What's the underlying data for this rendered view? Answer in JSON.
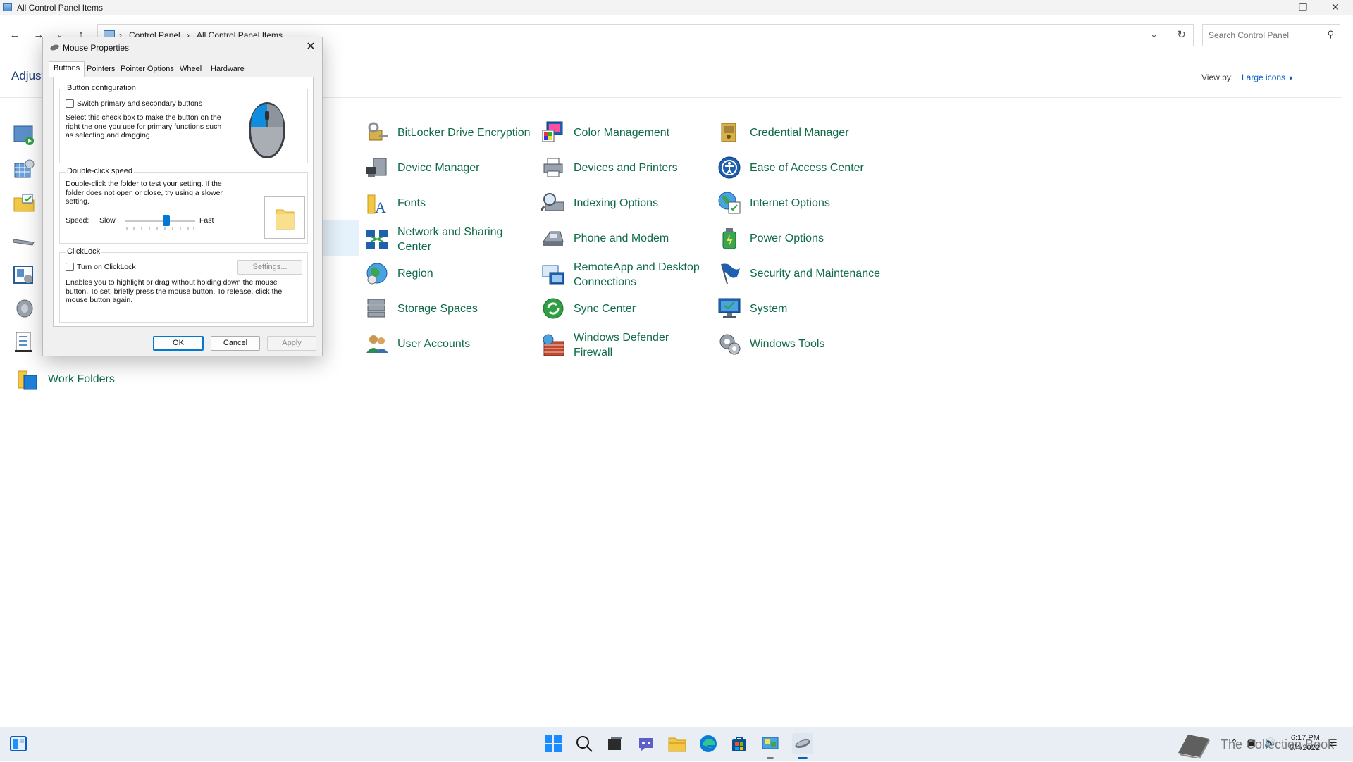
{
  "window": {
    "title": "All Control Panel Items"
  },
  "address": {
    "crumbs": [
      "Control Panel",
      "All Control Panel Items"
    ],
    "search_placeholder": "Search Control Panel"
  },
  "main": {
    "heading": "Adjust",
    "view_by_label": "View by:",
    "view_by_value": "Large icons",
    "items": [
      {
        "label": "BitLocker Drive Encryption",
        "icon": "bitlocker-icon"
      },
      {
        "label": "Color Management",
        "icon": "color-management-icon"
      },
      {
        "label": "Credential Manager",
        "icon": "credential-manager-icon"
      },
      {
        "label": "Device Manager",
        "icon": "device-manager-icon"
      },
      {
        "label": "Devices and Printers",
        "icon": "printer-icon"
      },
      {
        "label": "Ease of Access Center",
        "icon": "ease-of-access-icon"
      },
      {
        "label": "Fonts",
        "icon": "fonts-icon"
      },
      {
        "label": "Indexing Options",
        "icon": "indexing-icon"
      },
      {
        "label": "Internet Options",
        "icon": "internet-options-icon"
      },
      {
        "label_line1": "Network and Sharing",
        "label_line2": "Center",
        "icon": "network-icon"
      },
      {
        "label": "Phone and Modem",
        "icon": "phone-modem-icon"
      },
      {
        "label": "Power Options",
        "icon": "power-options-icon"
      },
      {
        "label": "Region",
        "icon": "region-icon"
      },
      {
        "label_line1": "RemoteApp and Desktop",
        "label_line2": "Connections",
        "icon": "remoteapp-icon"
      },
      {
        "label": "Security and Maintenance",
        "icon": "security-flag-icon"
      },
      {
        "label": "Storage Spaces",
        "icon": "storage-spaces-icon"
      },
      {
        "label": "Sync Center",
        "icon": "sync-center-icon"
      },
      {
        "label": "System",
        "icon": "system-monitor-icon"
      },
      {
        "label": "User Accounts",
        "icon": "user-accounts-icon"
      },
      {
        "label_line1": "Windows Defender",
        "label_line2": "Firewall",
        "icon": "firewall-icon"
      },
      {
        "label": "Windows Tools",
        "icon": "windows-tools-icon"
      }
    ],
    "left_column_last": "Work Folders"
  },
  "dialog": {
    "title": "Mouse Properties",
    "tabs": [
      "Buttons",
      "Pointers",
      "Pointer Options",
      "Wheel",
      "Hardware"
    ],
    "button_config": {
      "title": "Button configuration",
      "checkbox_label": "Switch primary and secondary buttons",
      "desc_line1": "Select this check box to make the button on the",
      "desc_line2": "right the one you use for primary functions such",
      "desc_line3": "as selecting and dragging."
    },
    "double_click": {
      "title": "Double-click speed",
      "desc_line1": "Double-click the folder to test your setting. If the",
      "desc_line2": "folder does not open or close, try using a slower",
      "desc_line3": "setting.",
      "speed_label": "Speed:",
      "slow": "Slow",
      "fast": "Fast",
      "slider_level": 0.6
    },
    "clicklock": {
      "title": "ClickLock",
      "checkbox_label": "Turn on ClickLock",
      "settings_button": "Settings...",
      "desc_line1": "Enables you to highlight or drag without holding down the mouse",
      "desc_line2": "button. To set, briefly press the mouse button. To release, click the",
      "desc_line3": "mouse button again."
    },
    "ok": "OK",
    "cancel": "Cancel",
    "apply": "Apply"
  },
  "taskbar": {
    "watermark": "The Collection Book",
    "time": "6:17 PM",
    "date": "5/4/2022"
  }
}
